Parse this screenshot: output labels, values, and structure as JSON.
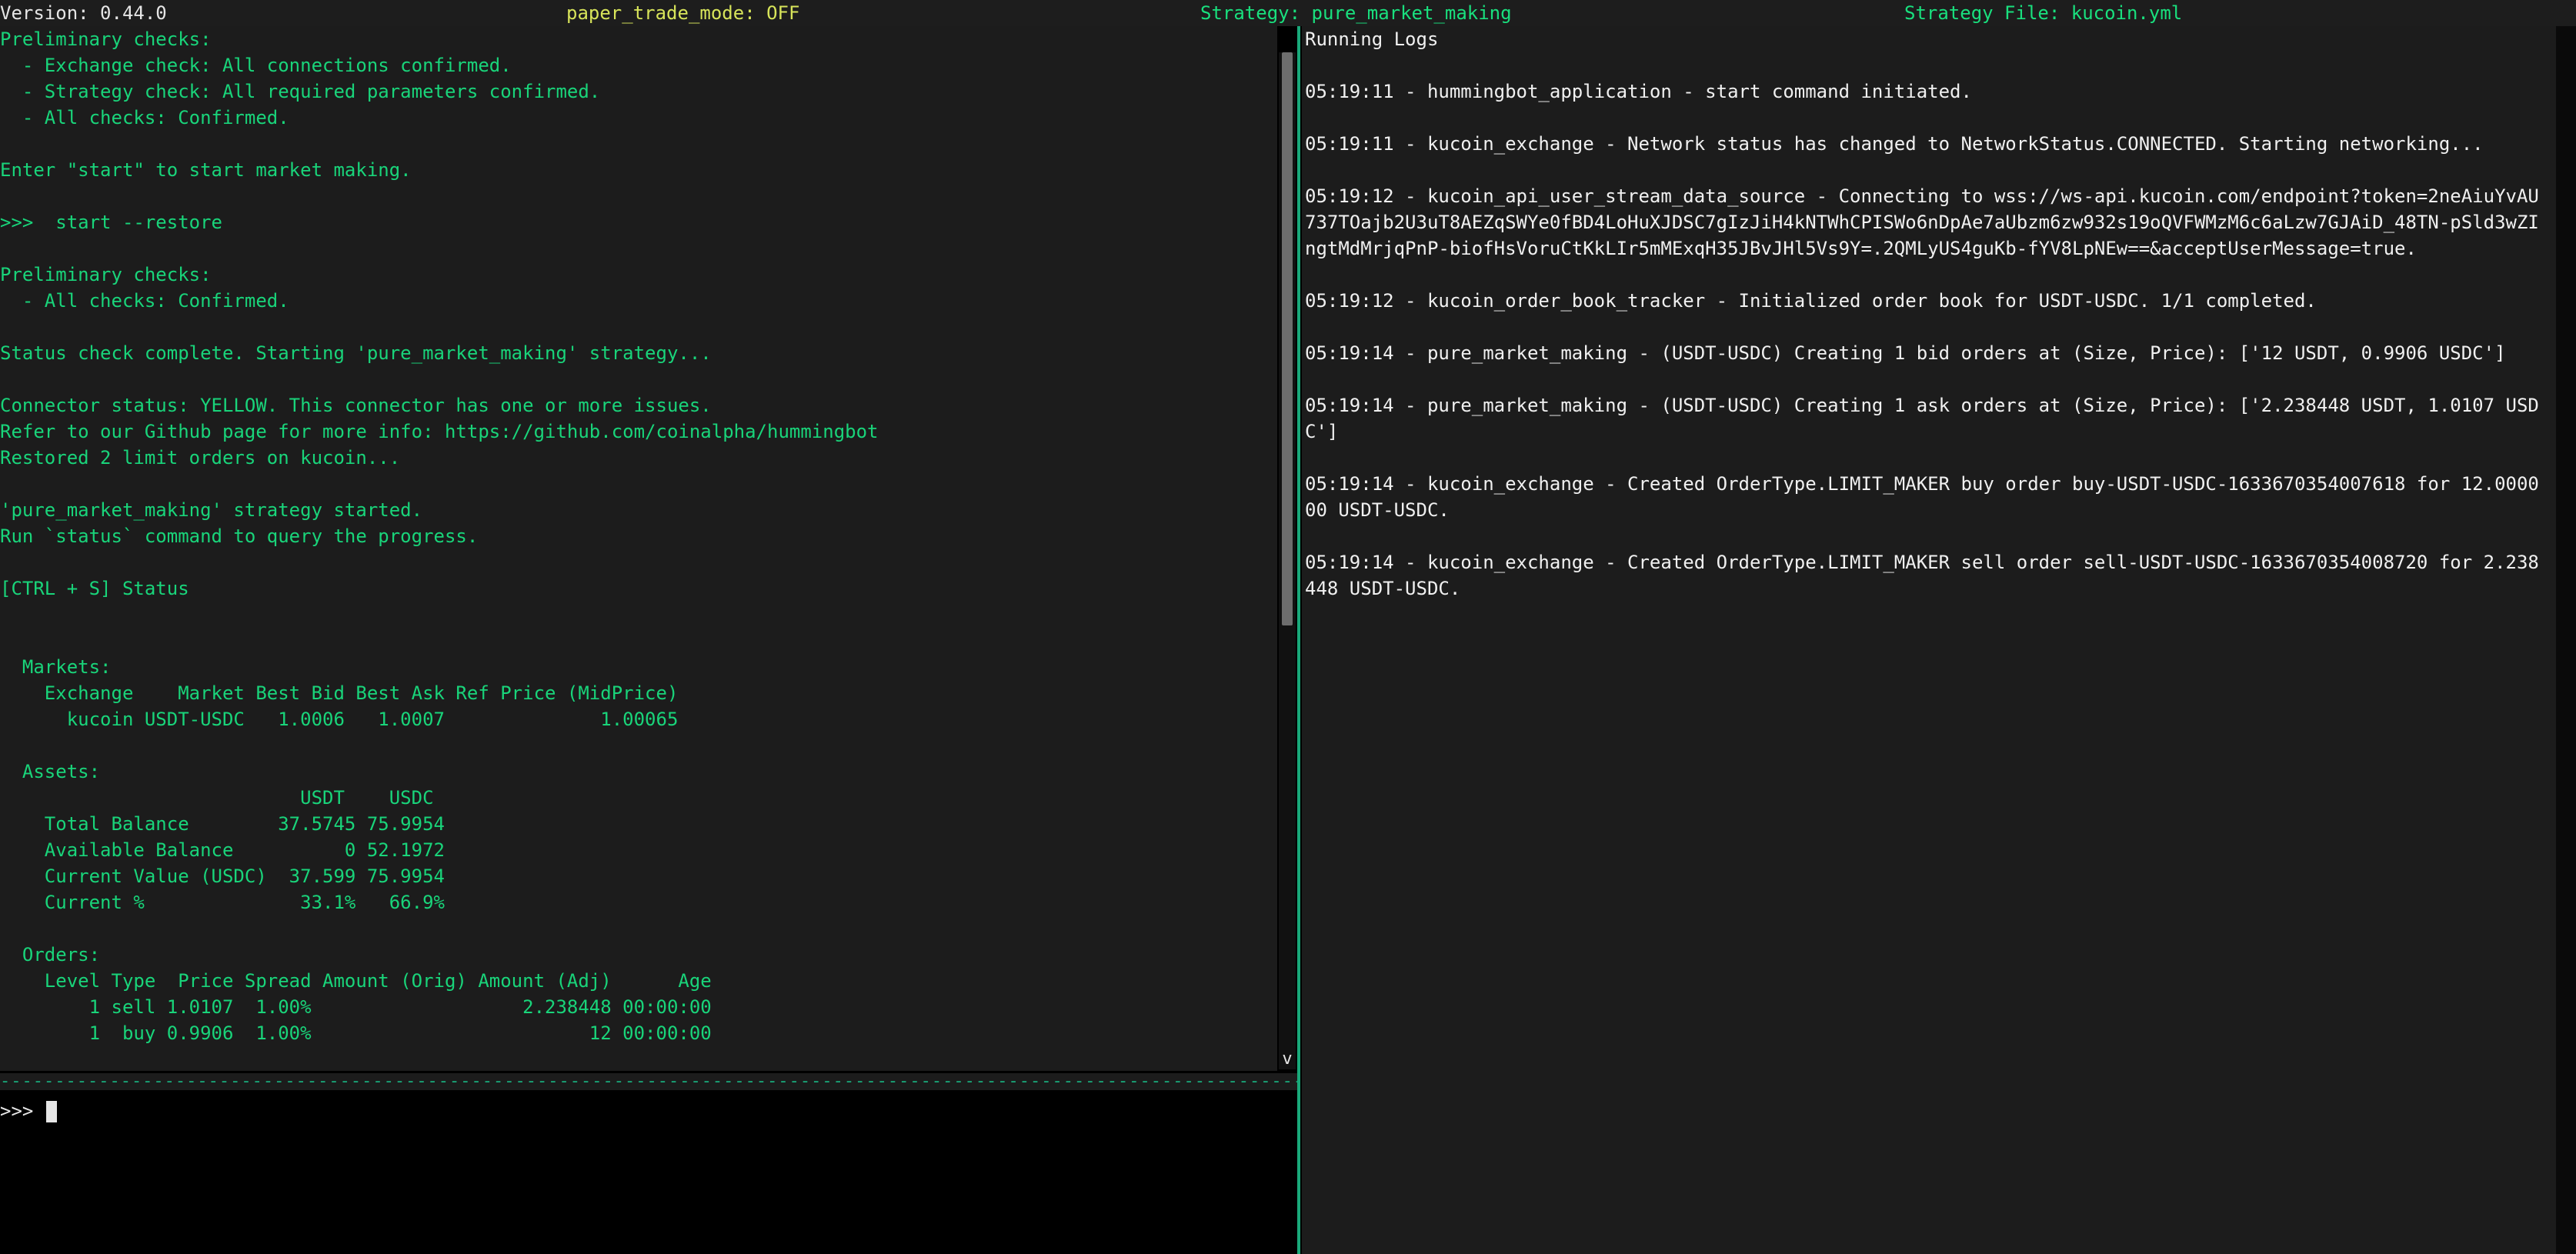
{
  "header": {
    "version": "Version: 0.44.0",
    "paper_trade_mode": "paper_trade_mode: OFF",
    "strategy": "Strategy: pure_market_making",
    "strategy_file": "Strategy File: kucoin.yml"
  },
  "output_pane": {
    "lines": [
      "Preliminary checks:",
      "  - Exchange check: All connections confirmed.",
      "  - Strategy check: All required parameters confirmed.",
      "  - All checks: Confirmed.",
      "",
      "Enter \"start\" to start market making.",
      "",
      ">>>  start --restore",
      "",
      "Preliminary checks:",
      "  - All checks: Confirmed.",
      "",
      "Status check complete. Starting 'pure_market_making' strategy...",
      "",
      "Connector status: YELLOW. This connector has one or more issues.",
      "Refer to our Github page for more info: https://github.com/coinalpha/hummingbot",
      "Restored 2 limit orders on kucoin...",
      "",
      "'pure_market_making' strategy started.",
      "Run `status` command to query the progress.",
      "",
      "[CTRL + S] Status",
      "",
      "",
      "  Markets:",
      "    Exchange    Market Best Bid Best Ask Ref Price (MidPrice)",
      "      kucoin USDT-USDC   1.0006   1.0007              1.00065",
      "",
      "  Assets:",
      "                           USDT    USDC",
      "    Total Balance        37.5745 75.9954",
      "    Available Balance          0 52.1972",
      "    Current Value (USDC)  37.599 75.9954",
      "    Current %              33.1%   66.9%",
      "",
      "  Orders:",
      "    Level Type  Price Spread Amount (Orig) Amount (Adj)      Age",
      "        1 sell 1.0107  1.00%                   2.238448 00:00:00",
      "        1  buy 0.9906  1.00%                         12 00:00:00"
    ],
    "scroll_down_label": "v"
  },
  "divider": "---------------------------------------------------------------------------------------------------------------------------",
  "input": {
    "prompt": ">>>"
  },
  "logs": {
    "title": "Running Logs",
    "entries": [
      "05:19:11 - hummingbot_application - start command initiated.",
      "05:19:11 - kucoin_exchange - Network status has changed to NetworkStatus.CONNECTED. Starting networking...",
      "05:19:12 - kucoin_api_user_stream_data_source - Connecting to wss://ws-api.kucoin.com/endpoint?token=2neAiuYvAU737TOajb2U3uT8AEZqSWYe0fBD4LoHuXJDSC7gIzJiH4kNTWhCPISWo6nDpAe7aUbzm6zw932s19oQVFWMzM6c6aLzw7GJAiD_48TN-pSld3wZIngtMdMrjqPnP-biofHsVoruCtKkLIr5mMExqH35JBvJHl5Vs9Y=.2QMLyUS4guKb-fYV8LpNEw==&acceptUserMessage=true.",
      "05:19:12 - kucoin_order_book_tracker - Initialized order book for USDT-USDC. 1/1 completed.",
      "05:19:14 - pure_market_making - (USDT-USDC) Creating 1 bid orders at (Size, Price): ['12 USDT, 0.9906 USDC']",
      "05:19:14 - pure_market_making - (USDT-USDC) Creating 1 ask orders at (Size, Price): ['2.238448 USDT, 1.0107 USDC']",
      "05:19:14 - kucoin_exchange - Created OrderType.LIMIT_MAKER buy order buy-USDT-USDC-1633670354007618 for 12.000000 USDT-USDC.",
      "05:19:14 - kucoin_exchange - Created OrderType.LIMIT_MAKER sell order sell-USDT-USDC-1633670354008720 for 2.238448 USDT-USDC."
    ]
  }
}
